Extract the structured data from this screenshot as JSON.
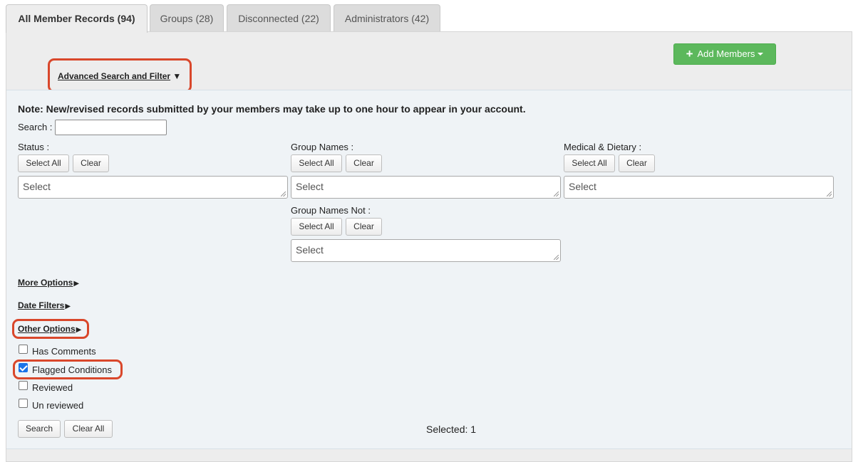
{
  "tabs": [
    {
      "label": "All Member Records (94)",
      "active": true
    },
    {
      "label": "Groups (28)",
      "active": false
    },
    {
      "label": "Disconnected (22)",
      "active": false
    },
    {
      "label": "Administrators (42)",
      "active": false
    }
  ],
  "toolbar": {
    "add_members_label": "Add Members"
  },
  "advanced_search": {
    "label": "Advanced Search and Filter",
    "arrow": "▼"
  },
  "note": "Note: New/revised records submitted by your members may take up to one hour to appear in your account.",
  "search": {
    "label": "Search :",
    "value": ""
  },
  "filters": {
    "status": {
      "label": "Status :",
      "select_all": "Select All",
      "clear": "Clear",
      "placeholder": "Select"
    },
    "group_names": {
      "label": "Group Names :",
      "select_all": "Select All",
      "clear": "Clear",
      "placeholder": "Select"
    },
    "medical_dietary": {
      "label": "Medical & Dietary :",
      "select_all": "Select All",
      "clear": "Clear",
      "placeholder": "Select"
    },
    "group_names_not": {
      "label": "Group Names Not :",
      "select_all": "Select All",
      "clear": "Clear",
      "placeholder": "Select"
    }
  },
  "sections": {
    "more_options": "More Options",
    "date_filters": "Date Filters",
    "other_options": "Other Options",
    "arrow": "▶"
  },
  "checkboxes": [
    {
      "label": "Has Comments",
      "checked": false
    },
    {
      "label": "Flagged Conditions",
      "checked": true
    },
    {
      "label": "Reviewed",
      "checked": false
    },
    {
      "label": "Un reviewed",
      "checked": false
    }
  ],
  "actions": {
    "search": "Search",
    "clear_all": "Clear All"
  },
  "selected_text": "Selected: 1",
  "colors": {
    "primary_green": "#5cb85c",
    "highlight_red": "#d9472b",
    "checkbox_blue": "#1a73e8"
  }
}
